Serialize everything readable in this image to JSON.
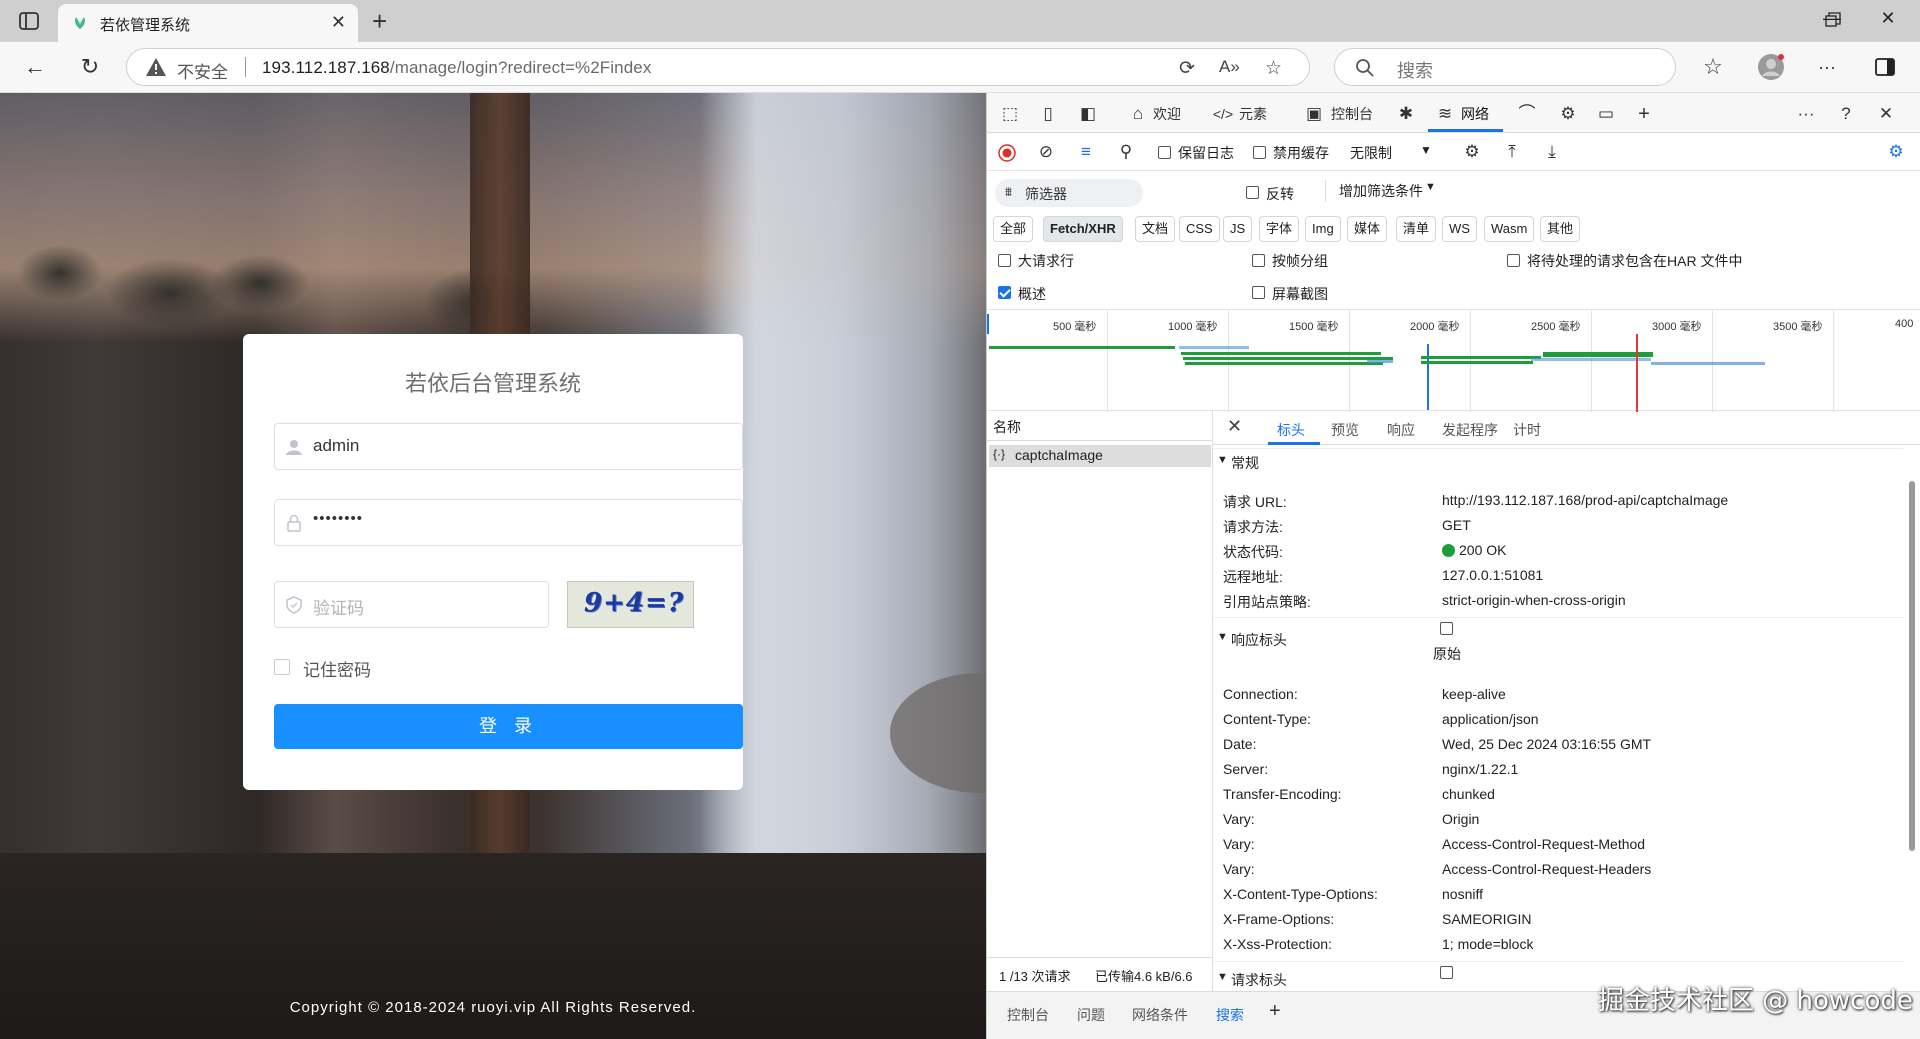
{
  "browser": {
    "tab_title": "若依管理系统",
    "insecure_label": "不安全",
    "url_host": "193.112.187.168",
    "url_path": "/manage/login?redirect=%2Findex",
    "search_placeholder": "搜索"
  },
  "page": {
    "login_title": "若依后台管理系统",
    "username_value": "admin",
    "password_mask": "••••••••",
    "captcha_placeholder": "验证码",
    "captcha_image_text": "9+4=?",
    "remember_label": "记住密码",
    "login_button": "登 录",
    "copyright": "Copyright © 2018-2024 ruoyi.vip All Rights Reserved."
  },
  "devtools": {
    "top_tabs": [
      "欢迎",
      "元素",
      "控制台",
      "网络"
    ],
    "toolbar": {
      "preserve_log": "保留日志",
      "disable_cache": "禁用缓存",
      "throttle": "无限制"
    },
    "filter": {
      "placeholder": "筛选器",
      "invert": "反转",
      "more_filters": "增加筛选条件"
    },
    "type_pills": [
      "全部",
      "Fetch/XHR",
      "文档",
      "CSS",
      "JS",
      "字体",
      "Img",
      "媒体",
      "清单",
      "WS",
      "Wasm",
      "其他"
    ],
    "options": {
      "big_rows": "大请求行",
      "group_by_frame": "按帧分组",
      "har_pending": "将待处理的请求包含在HAR 文件中",
      "overview": "概述",
      "screenshots": "屏幕截图"
    },
    "timeline_labels": [
      "500 毫秒",
      "1000 毫秒",
      "1500 毫秒",
      "2000 毫秒",
      "2500 毫秒",
      "3000 毫秒",
      "3500 毫秒",
      "400"
    ],
    "names_header": "名称",
    "request_name": "captchaImage",
    "status_summary": "1 /13 次请求",
    "transferred": "已传输4.6 kB/6.6",
    "detail_tabs": [
      "标头",
      "预览",
      "响应",
      "发起程序",
      "计时"
    ],
    "general_section": "常规",
    "general": [
      {
        "k": "请求 URL:",
        "v": "http://193.112.187.168/prod-api/captchaImage"
      },
      {
        "k": "请求方法:",
        "v": "GET"
      },
      {
        "k": "状态代码:",
        "v": "200 OK"
      },
      {
        "k": "远程地址:",
        "v": "127.0.0.1:51081"
      },
      {
        "k": "引用站点策略:",
        "v": "strict-origin-when-cross-origin"
      }
    ],
    "response_section": "响应标头",
    "raw_label": "原始",
    "response_headers": [
      {
        "k": "Connection:",
        "v": "keep-alive"
      },
      {
        "k": "Content-Type:",
        "v": "application/json"
      },
      {
        "k": "Date:",
        "v": "Wed, 25 Dec 2024 03:16:55 GMT"
      },
      {
        "k": "Server:",
        "v": "nginx/1.22.1"
      },
      {
        "k": "Transfer-Encoding:",
        "v": "chunked"
      },
      {
        "k": "Vary:",
        "v": "Origin"
      },
      {
        "k": "Vary:",
        "v": "Access-Control-Request-Method"
      },
      {
        "k": "Vary:",
        "v": "Access-Control-Request-Headers"
      },
      {
        "k": "X-Content-Type-Options:",
        "v": "nosniff"
      },
      {
        "k": "X-Frame-Options:",
        "v": "SAMEORIGIN"
      },
      {
        "k": "X-Xss-Protection:",
        "v": "1; mode=block"
      }
    ],
    "request_section": "请求标头",
    "drawer_tabs": [
      "控制台",
      "问题",
      "网络条件",
      "搜索"
    ]
  },
  "watermark": "掘金技术社区 @ howcode",
  "colors": {
    "accent": "#1890ff",
    "devtools_blue": "#1a73e8",
    "status_green": "#1e9e3a"
  }
}
